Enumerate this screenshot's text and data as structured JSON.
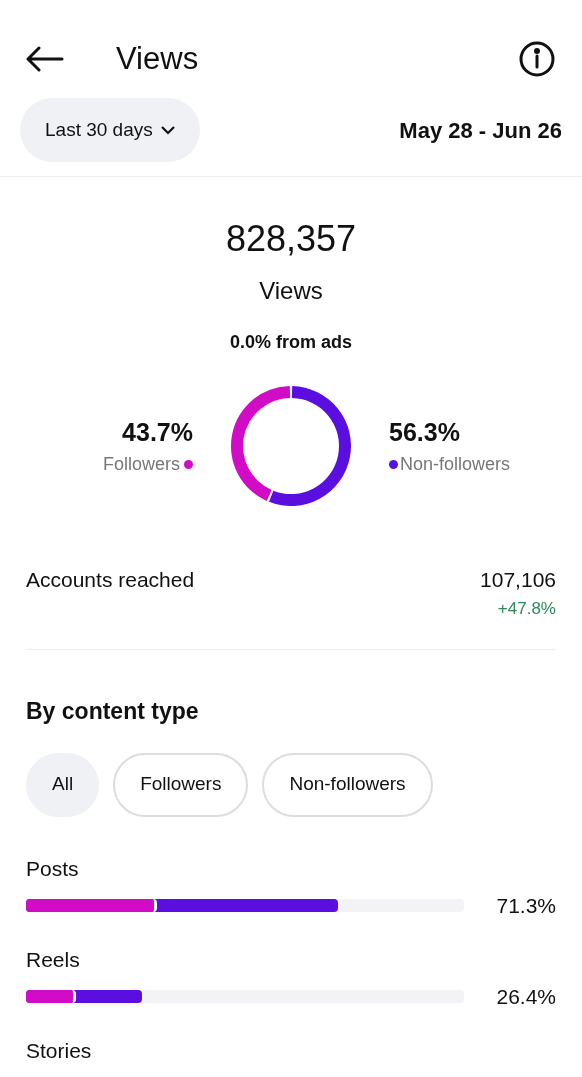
{
  "header": {
    "title": "Views"
  },
  "period": {
    "label": "Last 30 days",
    "range": "May 28 - Jun 26"
  },
  "summary": {
    "total": "828,357",
    "label": "Views",
    "ads_note": "0.0% from ads"
  },
  "split": {
    "legend": [
      {
        "percent": "43.7%",
        "color": "#d10bc6"
      },
      {
        "percent": "56.3%",
        "color": "#5a0ee0"
      }
    ],
    "chart_data": {
      "type": "donut",
      "categories": [
        "Followers",
        "Non-followers"
      ],
      "values": [
        43.7,
        56.3
      ]
    }
  },
  "accounts": {
    "label": "Accounts reached",
    "value": "107,106",
    "change": "+47.8%"
  },
  "content_type": {
    "title": "By content type",
    "filters": [
      {
        "label": "All",
        "selected": true
      },
      {
        "label": "Followers",
        "selected": false
      },
      {
        "label": "Non-followers",
        "selected": false
      }
    ],
    "rows": [
      {
        "label": "Posts",
        "value": "71.3%",
        "followers": {
          "level": 0.42,
          "color": "#d10bc6"
        },
        "non_followers": {
          "color": "#5a0ee0"
        }
      },
      {
        "label": "Reels",
        "value": "26.4%",
        "followers": {
          "level": 0.43,
          "color": "#d10bc6"
        },
        "non_followers": {
          "color": "#5a0ee0"
        }
      },
      {
        "label": "Stories"
      }
    ]
  }
}
